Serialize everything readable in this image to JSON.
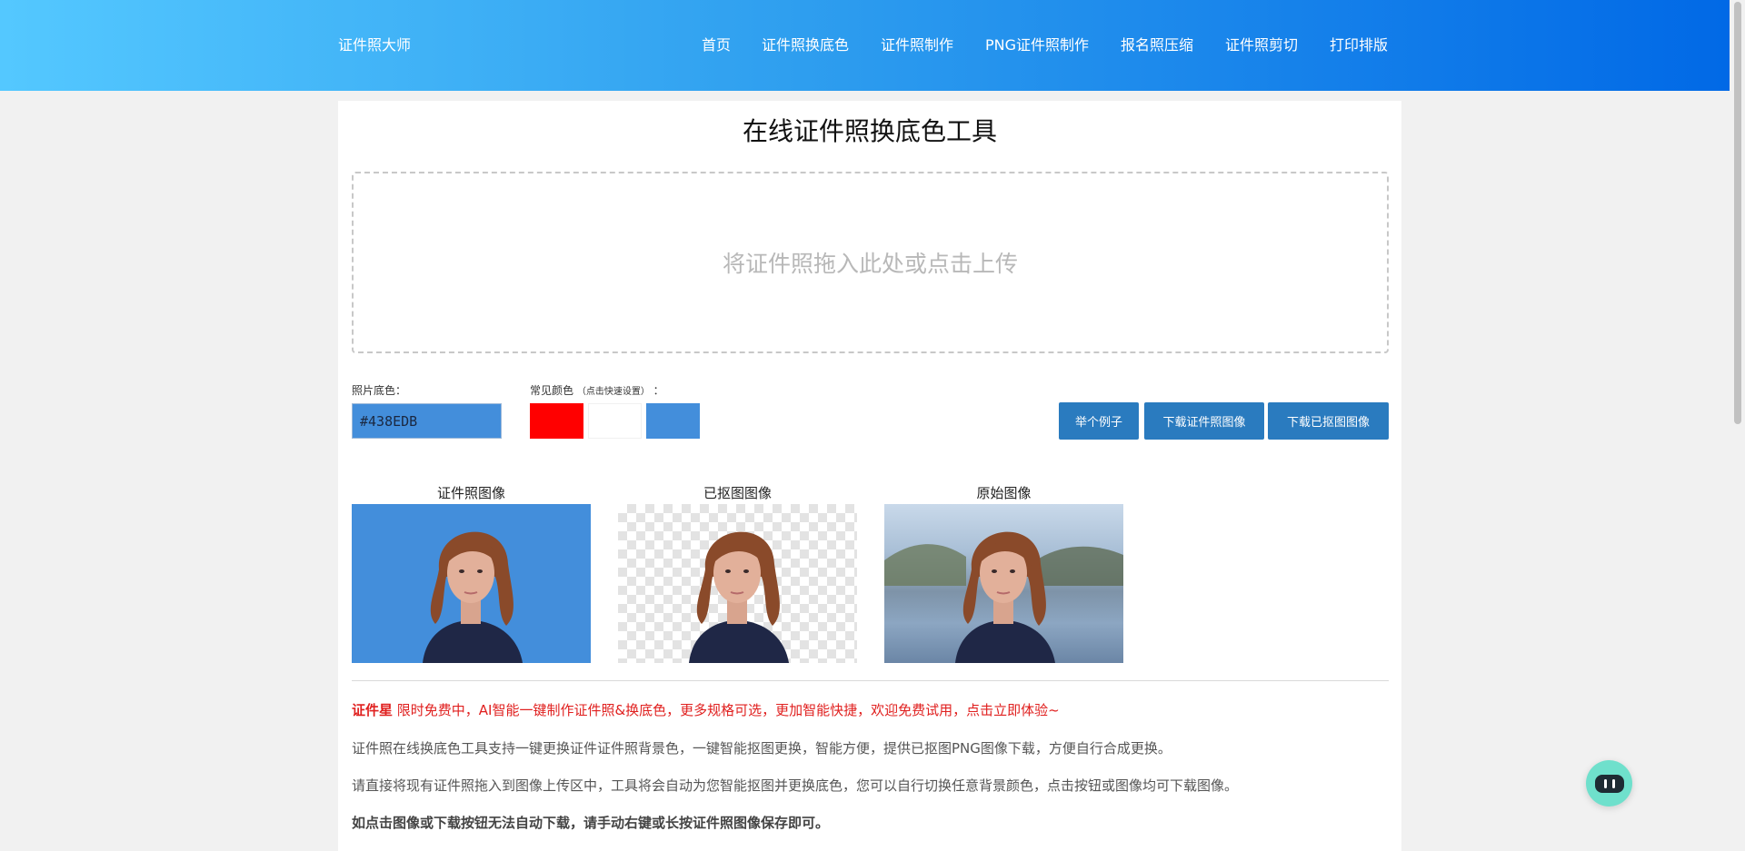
{
  "header": {
    "brand": "证件照大师",
    "nav": [
      {
        "label": "首页"
      },
      {
        "label": "证件照换底色"
      },
      {
        "label": "证件照制作"
      },
      {
        "label": "PNG证件照制作"
      },
      {
        "label": "报名照压缩"
      },
      {
        "label": "证件照剪切"
      },
      {
        "label": "打印排版"
      }
    ]
  },
  "main": {
    "title": "在线证件照换底色工具",
    "dropzone_text": "将证件照拖入此处或点击上传",
    "bg_color_label": "照片底色：",
    "bg_color_value": "#438EDB",
    "common_colors_label": "常见颜色",
    "common_colors_hint": "（点击快速设置）",
    "common_colors_suffix": "：",
    "swatches": [
      "#ff0000",
      "#ffffff",
      "#438edb"
    ],
    "buttons": {
      "example": "举个例子",
      "download_id": "下载证件照图像",
      "download_cutout": "下载已抠图图像"
    },
    "images": [
      {
        "label": "证件照图像"
      },
      {
        "label": "已抠图图像"
      },
      {
        "label": "原始图像"
      }
    ],
    "promo_brand": "证件星",
    "promo_text": " 限时免费中，AI智能一键制作证件照&换底色，更多规格可选，更加智能快捷，欢迎免费试用，点击立即体验~",
    "paragraph1": "证件照在线换底色工具支持一键更换证件证件照背景色，一键智能抠图更换，智能方便，提供已抠图PNG图像下载，方便自行合成更换。",
    "paragraph2": "请直接将现有证件照拖入到图像上传区中，工具将会自动为您智能抠图并更换底色，您可以自行切换任意背景颜色，点击按钮或图像均可下载图像。",
    "paragraph3": "如点击图像或下载按钮无法自动下载，请手动右键或长按证件照图像保存即可。"
  },
  "colors": {
    "header_start": "#54c8ff",
    "header_end": "#0068e6",
    "button": "#2a7bbf",
    "promo": "#e0201f"
  }
}
